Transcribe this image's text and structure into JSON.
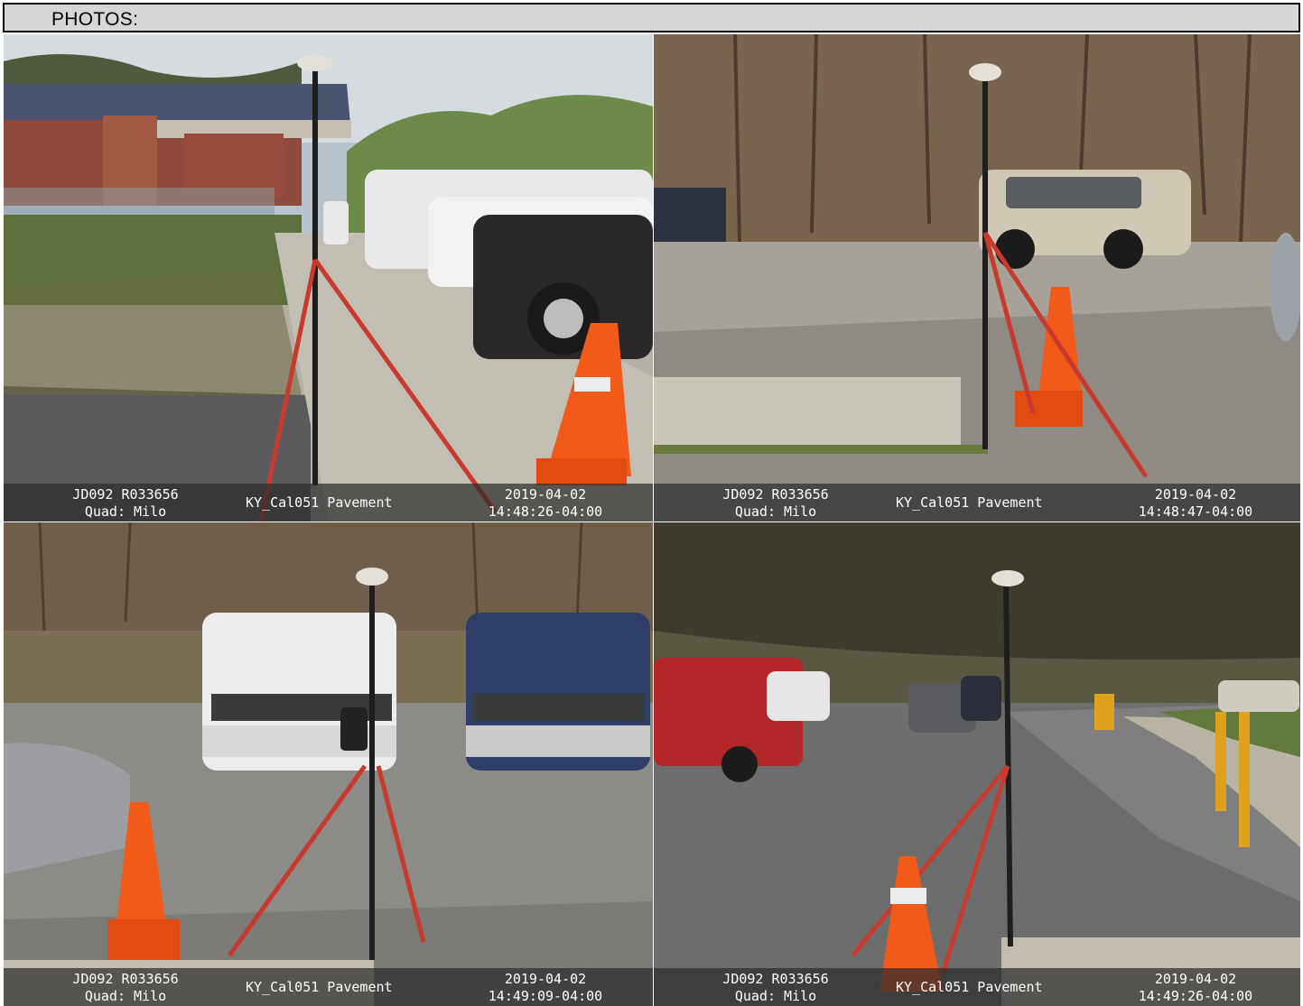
{
  "header": {
    "label": "PHOTOS:"
  },
  "photos": [
    {
      "code": "JD092 R033656",
      "quad": "Quad: Milo",
      "site": "KY_Cal051 Pavement",
      "date": "2019-04-02",
      "time": "14:48:26-04:00"
    },
    {
      "code": "JD092 R033656",
      "quad": "Quad: Milo",
      "site": "KY_Cal051 Pavement",
      "date": "2019-04-02",
      "time": "14:48:47-04:00"
    },
    {
      "code": "JD092 R033656",
      "quad": "Quad: Milo",
      "site": "KY_Cal051 Pavement",
      "date": "2019-04-02",
      "time": "14:49:09-04:00"
    },
    {
      "code": "JD092 R033656",
      "quad": "Quad: Milo",
      "site": "KY_Cal051 Pavement",
      "date": "2019-04-02",
      "time": "14:49:26-04:00"
    }
  ]
}
